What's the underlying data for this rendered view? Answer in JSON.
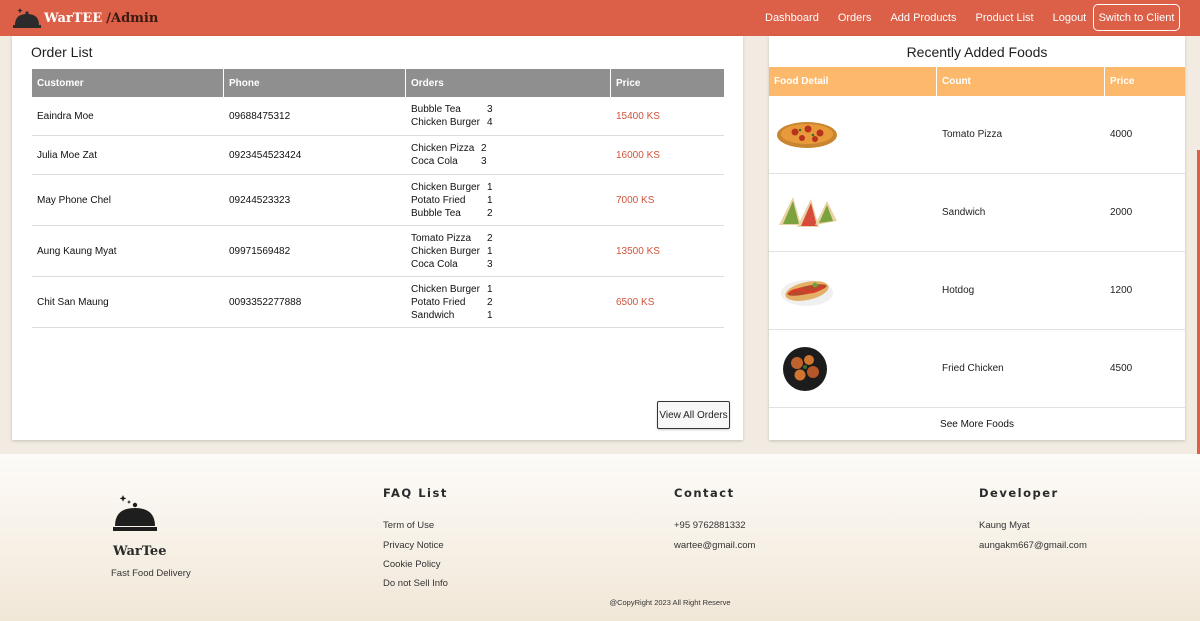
{
  "navbar": {
    "brand": "WarTEE",
    "brand_suffix": "/Admin",
    "links": [
      "Dashboard",
      "Orders",
      "Add Products",
      "Product List",
      "Logout"
    ],
    "switch_label": "Switch to Client",
    "color": "#dc5f47"
  },
  "orders": {
    "title": "Order List",
    "headers": [
      "Customer",
      "Phone",
      "Orders",
      "Price"
    ],
    "rows": [
      {
        "customer": "Eaindra Moe",
        "phone": "09688475312",
        "items": [
          [
            "Bubble Tea",
            "3"
          ],
          [
            "Chicken Burger",
            "4"
          ]
        ],
        "price": "15400 KS"
      },
      {
        "customer": "Julia Moe Zat",
        "phone": "0923454523424",
        "items": [
          [
            "Chicken Pizza",
            "2"
          ],
          [
            "Coca Cola",
            "3"
          ]
        ],
        "price": "16000 KS"
      },
      {
        "customer": "May Phone Chel",
        "phone": "09244523323",
        "items": [
          [
            "Chicken Burger",
            "1"
          ],
          [
            "Potato Fried",
            "1"
          ],
          [
            "Bubble Tea",
            "2"
          ]
        ],
        "price": "7000 KS"
      },
      {
        "customer": "Aung Kaung Myat",
        "phone": "09971569482",
        "items": [
          [
            "Tomato Pizza",
            "2"
          ],
          [
            "Chicken Burger",
            "1"
          ],
          [
            "Coca Cola",
            "3"
          ]
        ],
        "price": "13500 KS"
      },
      {
        "customer": "Chit San Maung",
        "phone": "0093352277888",
        "items": [
          [
            "Chicken Burger",
            "1"
          ],
          [
            "Potato Fried",
            "2"
          ],
          [
            "Sandwich",
            "1"
          ]
        ],
        "price": "6500 KS"
      }
    ],
    "view_all_label": "View All Orders"
  },
  "foods": {
    "title": "Recently Added Foods",
    "headers": [
      "Food Detail",
      "Count",
      "Price"
    ],
    "rows": [
      {
        "name": "Tomato Pizza",
        "price": "4000",
        "icon": "pizza-image"
      },
      {
        "name": "Sandwich",
        "price": "2000",
        "icon": "sandwich-image"
      },
      {
        "name": "Hotdog",
        "price": "1200",
        "icon": "hotdog-image"
      },
      {
        "name": "Fried Chicken",
        "price": "4500",
        "icon": "fried-chicken-image"
      }
    ],
    "see_more_label": "See More Foods",
    "header_color": "#fcb86b"
  },
  "footer": {
    "brand": "WarTee",
    "tagline": "Fast Food Delivery",
    "faq_title": "FAQ List",
    "faq_items": [
      "Term of Use",
      "Privacy Notice",
      "Cookie Policy",
      "Do not Sell Info"
    ],
    "contact_title": "Contact",
    "contact_items": [
      "+95 9762881332",
      "wartee@gmail.com"
    ],
    "developer_title": "Developer",
    "developer_items": [
      "Kaung Myat",
      "aungakm667@gmail.com"
    ],
    "copyright": "@CopyRight 2023 All Right Reserve"
  }
}
